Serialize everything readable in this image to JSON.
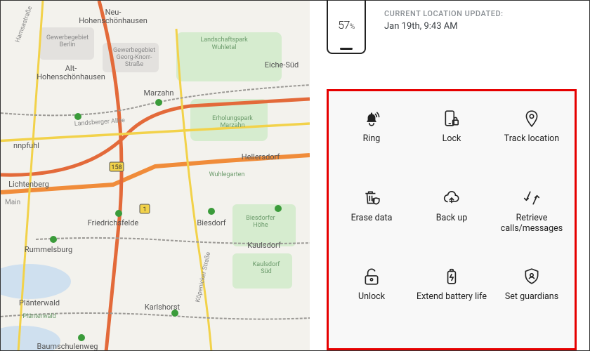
{
  "device": {
    "battery_percent": "57",
    "battery_percent_symbol": "%"
  },
  "location": {
    "updated_label": "CURRENT LOCATION UPDATED:",
    "updated_time": "Jan 19th, 9:43 AM"
  },
  "actions": {
    "ring": "Ring",
    "lock": "Lock",
    "track": "Track location",
    "erase": "Erase data",
    "backup": "Back up",
    "retrieve": "Retrieve calls/messages",
    "unlock": "Unlock",
    "battery": "Extend battery life",
    "guardians": "Set guardians"
  },
  "map": {
    "labels": [
      "Neu-Hohenschönhausen",
      "Gewerbegebiet Berlin",
      "Alt-Hohenschönhausen",
      "Gewerbegebiet Georg-Knorr-Straße",
      "Marzahn",
      "Landschaftspark Wuhletal",
      "Eiche-Süd",
      "nnpfuhl",
      "Landsberger Allee",
      "Hellersdorf",
      "Lichtenberg",
      "Wuhlegarten",
      "Friedrichsfelde",
      "Biesdorf",
      "Biesdorfer Höhe",
      "Rummelsburg",
      "Kaulsdorf",
      "Kaulsdorf Süd",
      "Plänterwald",
      "Karlshorst",
      "Baumschulenweg",
      "Köpenicker Straße",
      "Erholungspark Marzahn",
      "Hamsastraße",
      "Main",
      "Plänterwald",
      "158",
      "1"
    ]
  }
}
